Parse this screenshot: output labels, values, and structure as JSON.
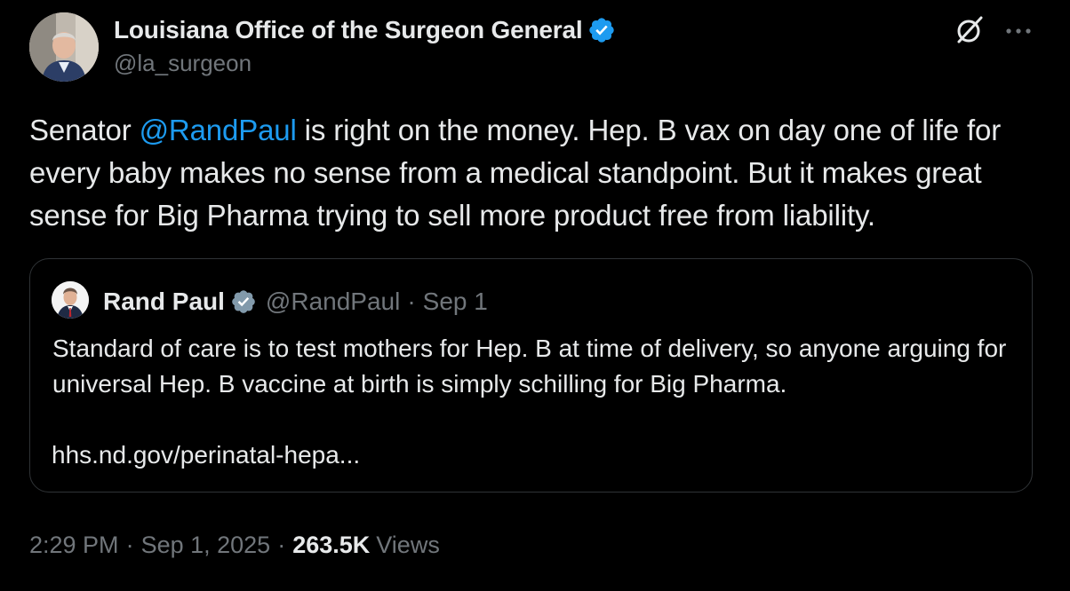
{
  "author": {
    "name": "Louisiana Office of the Surgeon General",
    "handle": "@la_surgeon",
    "verified_color": "#1d9bf0"
  },
  "header_icons": [
    "grok-icon",
    "more-icon"
  ],
  "tweet": {
    "text_before": "Senator ",
    "mention": "@RandPaul",
    "text_after": " is right on the money. Hep. B vax on day one of life for every baby makes no sense from a medical standpoint. But it makes great sense for Big Pharma trying to sell more product free from liability."
  },
  "quote": {
    "name": "Rand Paul",
    "handle": "@RandPaul",
    "separator": "·",
    "date": "Sep 1",
    "text": "Standard of care is to test mothers for Hep. B at time of delivery, so anyone arguing for universal Hep. B vaccine at birth is simply schilling for Big Pharma.",
    "link": "hhs.nd.gov/perinatal-hepa..."
  },
  "meta": {
    "time": "2:29 PM",
    "separator": "·",
    "date": "Sep 1, 2025",
    "views_count": "263.5K",
    "views_label": "Views"
  },
  "colors": {
    "background": "#000000",
    "text": "#e7e9ea",
    "secondary": "#71767b",
    "accent": "#1d9bf0",
    "border": "#2f3336"
  }
}
